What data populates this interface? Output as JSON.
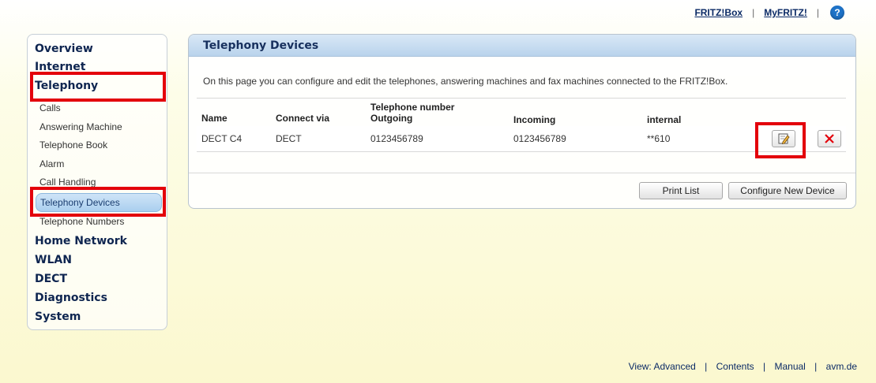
{
  "topnav": {
    "fritzbox": "FRITZ!Box",
    "myfritz": "MyFRITZ!",
    "sep": "|",
    "help": "?"
  },
  "sidebar": {
    "overview": "Overview",
    "internet": "Internet",
    "telephony": "Telephony",
    "calls": "Calls",
    "answering": "Answering Machine",
    "phonebook": "Telephone Book",
    "alarm": "Alarm",
    "callhandling": "Call Handling",
    "devices": "Telephony Devices",
    "numbers": "Telephone Numbers",
    "homenetwork": "Home Network",
    "wlan": "WLAN",
    "dect": "DECT",
    "diagnostics": "Diagnostics",
    "system": "System"
  },
  "panel": {
    "title": "Telephony Devices",
    "description": "On this page you can configure and edit the telephones, answering machines and fax machines connected to the FRITZ!Box.",
    "columns": {
      "name": "Name",
      "connect": "Connect via",
      "telnum": "Telephone number",
      "outgoing": "Outgoing",
      "incoming": "Incoming",
      "internal": "internal"
    },
    "rows": [
      {
        "name": "DECT C4",
        "connect": "DECT",
        "outgoing": "0123456789",
        "incoming": "0123456789",
        "internal": "**610"
      }
    ],
    "print_label": "Print List",
    "configure_label": "Configure New Device"
  },
  "footer": {
    "view": "View: Advanced",
    "contents": "Contents",
    "manual": "Manual",
    "avm": "avm.de",
    "sep": "|"
  },
  "colors": {
    "highlight": "#e3000b",
    "nav": "#0b2a66",
    "active": "#aacfef"
  }
}
